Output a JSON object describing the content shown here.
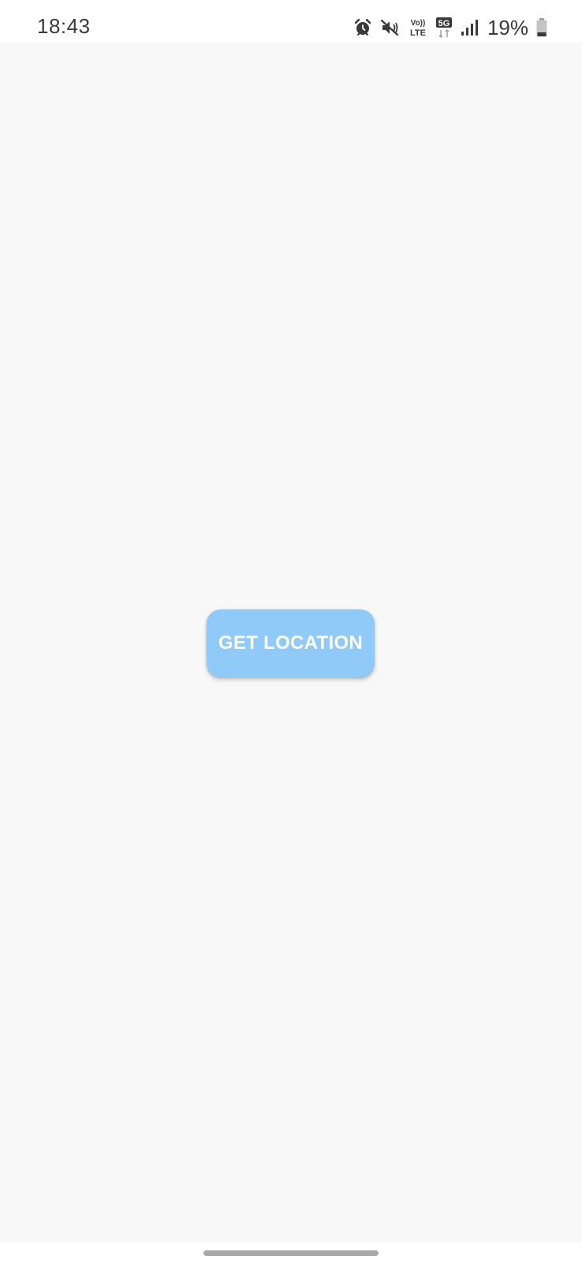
{
  "status_bar": {
    "time": "18:43",
    "volte_label_top": "Vo))",
    "volte_label_bottom": "LTE",
    "network_type": "5G",
    "battery_percent": "19%",
    "icons": [
      "alarm-icon",
      "mute-icon",
      "volte-icon",
      "5g-icon",
      "signal-icon",
      "battery-icon"
    ]
  },
  "main": {
    "get_location_label": "GET LOCATION"
  },
  "colors": {
    "background": "#f8f8f8",
    "button": "#90caf9",
    "button_text": "#ffffff",
    "status_text": "#3a3a3a"
  }
}
